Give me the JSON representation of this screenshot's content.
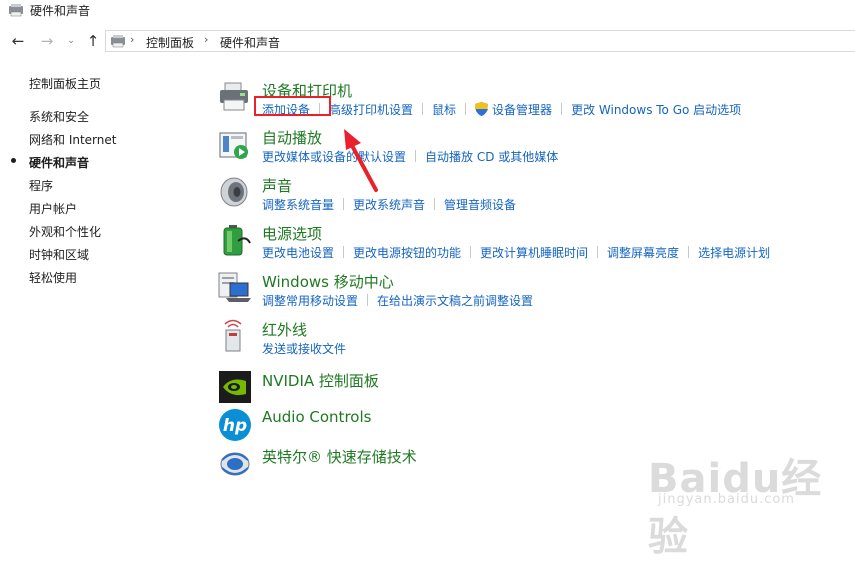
{
  "window": {
    "title": "硬件和声音"
  },
  "breadcrumb": [
    "控制面板",
    "硬件和声音"
  ],
  "leftnav": {
    "items": [
      "控制面板主页",
      "系统和安全",
      "网络和 Internet",
      "硬件和声音",
      "程序",
      "用户帐户",
      "外观和个性化",
      "时钟和区域",
      "轻松使用"
    ],
    "current_index": 3
  },
  "categories": [
    {
      "title": "设备和打印机",
      "icon": "printer-icon",
      "links": [
        "添加设备",
        "高级打印机设置",
        "鼠标",
        "设备管理器",
        "更改 Windows To Go 启动选项"
      ]
    },
    {
      "title": "自动播放",
      "icon": "autoplay-icon",
      "links": [
        "更改媒体或设备的默认设置",
        "自动播放 CD 或其他媒体"
      ]
    },
    {
      "title": "声音",
      "icon": "speaker-icon",
      "links": [
        "调整系统音量",
        "更改系统声音",
        "管理音频设备"
      ]
    },
    {
      "title": "电源选项",
      "icon": "battery-icon",
      "links": [
        "更改电池设置",
        "更改电源按钮的功能",
        "更改计算机睡眠时间",
        "调整屏幕亮度",
        "选择电源计划"
      ]
    },
    {
      "title": "Windows 移动中心",
      "icon": "laptop-icon",
      "links": [
        "调整常用移动设置",
        "在给出演示文稿之前调整设置"
      ]
    },
    {
      "title": "红外线",
      "icon": "infrared-icon",
      "links": [
        "发送或接收文件"
      ]
    },
    {
      "title": "NVIDIA 控制面板",
      "icon": "nvidia-icon",
      "links": []
    },
    {
      "title": "Audio Controls",
      "icon": "hp-icon",
      "links": []
    },
    {
      "title": "英特尔® 快速存储技术",
      "icon": "intel-rst-icon",
      "links": []
    }
  ],
  "watermark": {
    "logo": "Baidu经验",
    "url": "jingyan.baidu.com"
  },
  "colors": {
    "heading": "#1e7a22",
    "link": "#1565c0",
    "annotation": "#e8212b"
  }
}
